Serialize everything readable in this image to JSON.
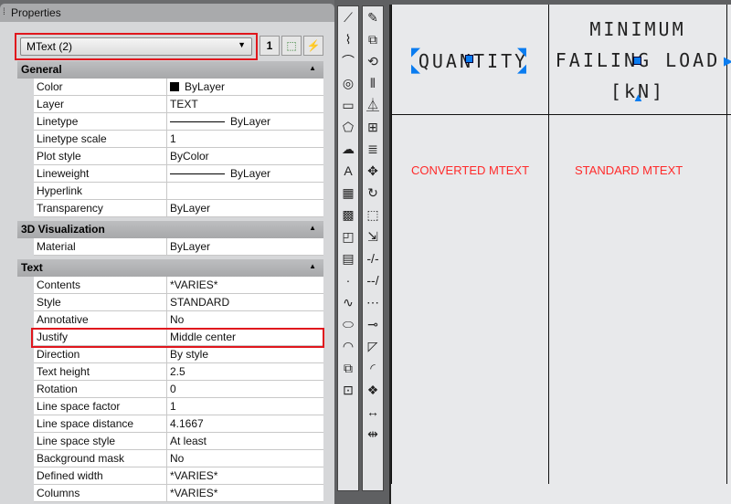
{
  "panel": {
    "title": "Properties",
    "selection": "MText (2)",
    "toggle_label": "1"
  },
  "sections": [
    {
      "title": "General",
      "rows": [
        {
          "label": "Color",
          "value": "ByLayer",
          "kind": "swatch"
        },
        {
          "label": "Layer",
          "value": "TEXT"
        },
        {
          "label": "Linetype",
          "value": "ByLayer",
          "kind": "line"
        },
        {
          "label": "Linetype scale",
          "value": "1"
        },
        {
          "label": "Plot style",
          "value": "ByColor"
        },
        {
          "label": "Lineweight",
          "value": "ByLayer",
          "kind": "line"
        },
        {
          "label": "Hyperlink",
          "value": ""
        },
        {
          "label": "Transparency",
          "value": "ByLayer"
        }
      ]
    },
    {
      "title": "3D Visualization",
      "rows": [
        {
          "label": "Material",
          "value": "ByLayer"
        }
      ]
    },
    {
      "title": "Text",
      "rows": [
        {
          "label": "Contents",
          "value": "*VARIES*"
        },
        {
          "label": "Style",
          "value": "STANDARD"
        },
        {
          "label": "Annotative",
          "value": "No"
        },
        {
          "label": "Justify",
          "value": "Middle center"
        },
        {
          "label": "Direction",
          "value": "By style"
        },
        {
          "label": "Text height",
          "value": "2.5"
        },
        {
          "label": "Rotation",
          "value": "0"
        },
        {
          "label": "Line space factor",
          "value": "1"
        },
        {
          "label": "Line space distance",
          "value": "4.1667"
        },
        {
          "label": "Line space style",
          "value": "At least"
        },
        {
          "label": "Background mask",
          "value": "No"
        },
        {
          "label": "Defined width",
          "value": "*VARIES*"
        },
        {
          "label": "Columns",
          "value": "*VARIES*"
        }
      ]
    }
  ],
  "toolbar1": [
    "line",
    "polyline",
    "arc",
    "circle",
    "rectangle",
    "polygon",
    "revcloud",
    "text",
    "hatch",
    "gradient",
    "region",
    "table",
    "point",
    "spline",
    "ellipse",
    "ellipse-arc",
    "block",
    "insert"
  ],
  "toolbar2": [
    "erase",
    "copy",
    "copy-rotate",
    "offset",
    "mirror",
    "array",
    "mtext-edit",
    "move",
    "rotate",
    "scale",
    "stretch",
    "trim",
    "extend",
    "break",
    "join",
    "chamfer",
    "fillet",
    "explode",
    "dimension",
    "dim-continue"
  ],
  "drawing": {
    "cell1": "QUANTITY",
    "cell2_lines": [
      "MINIMUM",
      "FAILING LOAD",
      "[kN]"
    ],
    "label1": "CONVERTED MTEXT",
    "label2": "STANDARD MTEXT",
    "grip_color": "#0a7cf0",
    "label_color": "#ff2a2a"
  }
}
